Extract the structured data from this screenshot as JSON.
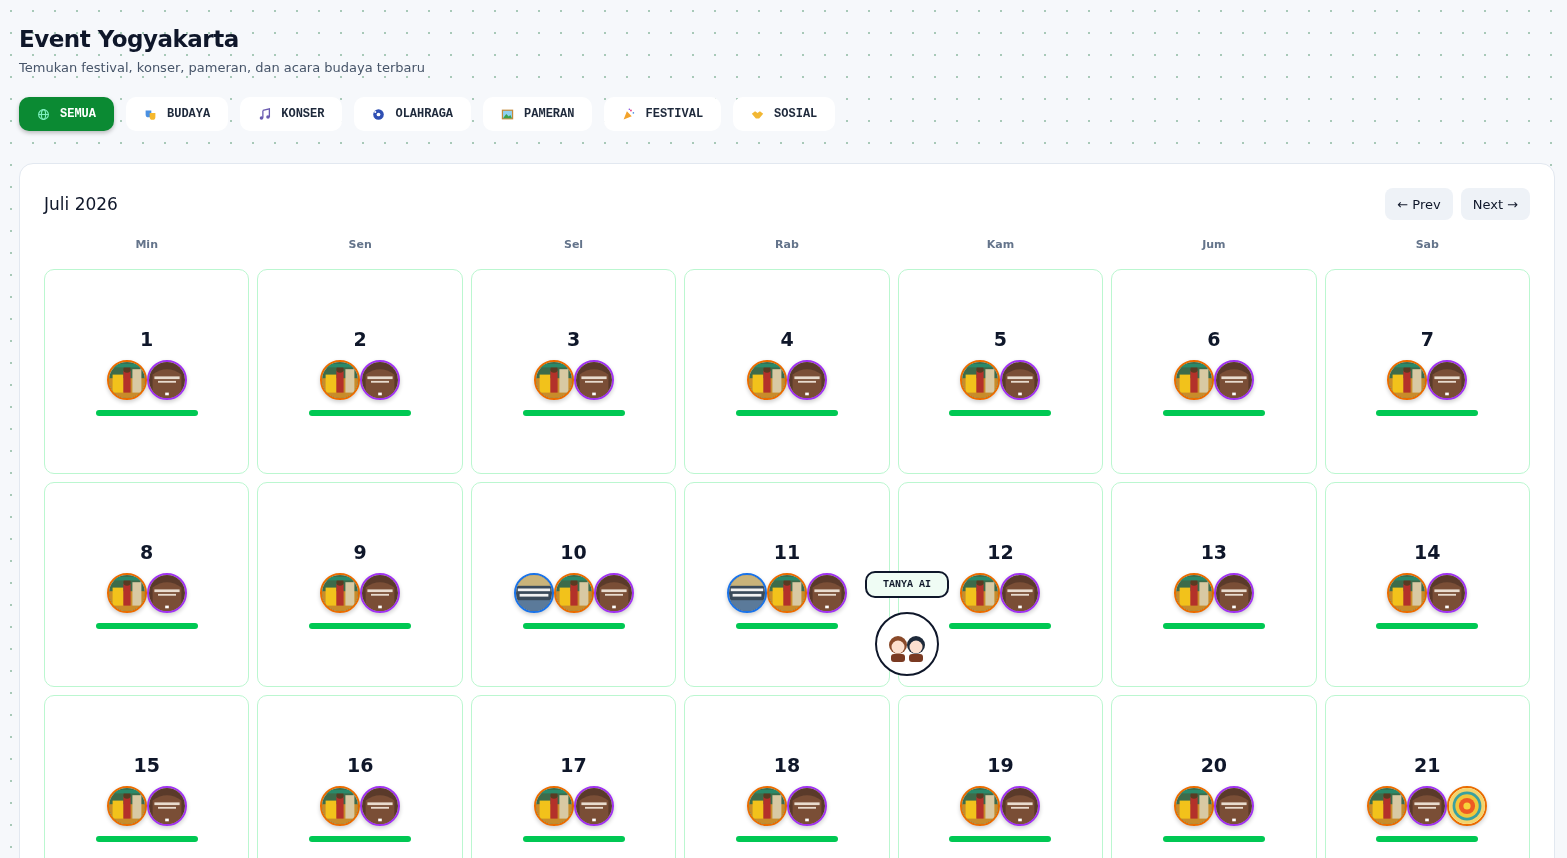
{
  "header": {
    "title": "Event Yogyakarta",
    "subtitle": "Temukan festival, konser, pameran, dan acara budaya terbaru"
  },
  "tabs": [
    {
      "label": "SEMUA",
      "selected": true
    },
    {
      "label": "BUDAYA",
      "selected": false
    },
    {
      "label": "KONSER",
      "selected": false
    },
    {
      "label": "OLAHRAGA",
      "selected": false
    },
    {
      "label": "PAMERAN",
      "selected": false
    },
    {
      "label": "FESTIVAL",
      "selected": false
    },
    {
      "label": "SOSIAL",
      "selected": false
    }
  ],
  "calendar": {
    "month": "Juli 2026",
    "prev": "← Prev",
    "next": "Next →",
    "weekdays": [
      "Min",
      "Sen",
      "Sel",
      "Rab",
      "Kam",
      "Jum",
      "Sab"
    ],
    "days": [
      {
        "day": "1",
        "events": [
          {
            "kind": "dance",
            "color": "#ea6c00"
          },
          {
            "kind": "stage",
            "color": "#a033f0"
          }
        ]
      },
      {
        "day": "2",
        "events": [
          {
            "kind": "dance",
            "color": "#ea6c00"
          },
          {
            "kind": "stage",
            "color": "#a033f0"
          }
        ]
      },
      {
        "day": "3",
        "events": [
          {
            "kind": "dance",
            "color": "#ea6c00"
          },
          {
            "kind": "stage",
            "color": "#a033f0"
          }
        ]
      },
      {
        "day": "4",
        "events": [
          {
            "kind": "dance",
            "color": "#ea6c00"
          },
          {
            "kind": "stage",
            "color": "#a033f0"
          }
        ]
      },
      {
        "day": "5",
        "events": [
          {
            "kind": "dance",
            "color": "#ea6c00"
          },
          {
            "kind": "stage",
            "color": "#a033f0"
          }
        ]
      },
      {
        "day": "6",
        "events": [
          {
            "kind": "dance",
            "color": "#ea6c00"
          },
          {
            "kind": "stage",
            "color": "#a033f0"
          }
        ]
      },
      {
        "day": "7",
        "events": [
          {
            "kind": "dance",
            "color": "#ea6c00"
          },
          {
            "kind": "stage",
            "color": "#a033f0"
          }
        ]
      },
      {
        "day": "8",
        "events": [
          {
            "kind": "dance",
            "color": "#ea6c00"
          },
          {
            "kind": "stage",
            "color": "#a033f0"
          }
        ]
      },
      {
        "day": "9",
        "events": [
          {
            "kind": "dance",
            "color": "#ea6c00"
          },
          {
            "kind": "stage",
            "color": "#a033f0"
          }
        ]
      },
      {
        "day": "10",
        "events": [
          {
            "kind": "crowd",
            "color": "#1a73e8"
          },
          {
            "kind": "dance",
            "color": "#ea6c00"
          },
          {
            "kind": "stage",
            "color": "#a033f0"
          }
        ]
      },
      {
        "day": "11",
        "events": [
          {
            "kind": "crowd",
            "color": "#1a73e8"
          },
          {
            "kind": "dance",
            "color": "#ea6c00"
          },
          {
            "kind": "stage",
            "color": "#a033f0"
          }
        ]
      },
      {
        "day": "12",
        "events": [
          {
            "kind": "dance",
            "color": "#ea6c00"
          },
          {
            "kind": "stage",
            "color": "#a033f0"
          }
        ]
      },
      {
        "day": "13",
        "events": [
          {
            "kind": "dance",
            "color": "#ea6c00"
          },
          {
            "kind": "stage",
            "color": "#a033f0"
          }
        ]
      },
      {
        "day": "14",
        "events": [
          {
            "kind": "dance",
            "color": "#ea6c00"
          },
          {
            "kind": "stage",
            "color": "#a033f0"
          }
        ]
      },
      {
        "day": "15",
        "events": [
          {
            "kind": "dance",
            "color": "#ea6c00"
          },
          {
            "kind": "stage",
            "color": "#a033f0"
          }
        ]
      },
      {
        "day": "16",
        "events": [
          {
            "kind": "dance",
            "color": "#ea6c00"
          },
          {
            "kind": "stage",
            "color": "#a033f0"
          }
        ]
      },
      {
        "day": "17",
        "events": [
          {
            "kind": "dance",
            "color": "#ea6c00"
          },
          {
            "kind": "stage",
            "color": "#a033f0"
          }
        ]
      },
      {
        "day": "18",
        "events": [
          {
            "kind": "dance",
            "color": "#ea6c00"
          },
          {
            "kind": "stage",
            "color": "#a033f0"
          }
        ]
      },
      {
        "day": "19",
        "events": [
          {
            "kind": "dance",
            "color": "#ea6c00"
          },
          {
            "kind": "stage",
            "color": "#a033f0"
          }
        ]
      },
      {
        "day": "20",
        "events": [
          {
            "kind": "dance",
            "color": "#ea6c00"
          },
          {
            "kind": "stage",
            "color": "#a033f0"
          }
        ]
      },
      {
        "day": "21",
        "events": [
          {
            "kind": "dance",
            "color": "#ea6c00"
          },
          {
            "kind": "stage",
            "color": "#a033f0"
          },
          {
            "kind": "emblem",
            "color": "#ea6c00"
          }
        ]
      }
    ]
  },
  "assistant": {
    "label": "TANYA AI"
  }
}
